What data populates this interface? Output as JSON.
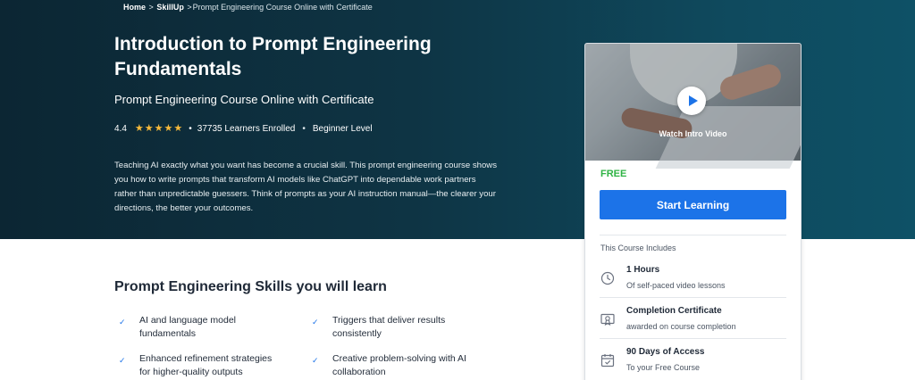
{
  "breadcrumb": {
    "home": "Home",
    "sep1": ">",
    "skillup": "SkillUp",
    "sep2": ">",
    "current": "Prompt Engineering Course Online with Certificate"
  },
  "course": {
    "title": "Introduction to Prompt Engineering Fundamentals",
    "subtitle": "Prompt Engineering Course Online with Certificate",
    "rating": "4.4",
    "rating_stars": 5,
    "learners": "37735 Learners Enrolled",
    "level": "Beginner Level",
    "meta_separator": "•",
    "description": "Teaching AI exactly what you want has become a crucial skill. This prompt engineering course shows you how to write prompts that transform AI models like ChatGPT into dependable work partners rather than unpredictable guessers. Think of prompts as your AI instruction manual—the clearer your directions, the better your outcomes."
  },
  "card": {
    "video_label": "Watch Intro Video",
    "price": "FREE",
    "cta_label": "Start Learning",
    "includes_title": "This Course Includes",
    "includes": [
      {
        "icon": "clock-icon",
        "title": "1 Hours",
        "subtitle": "Of self-paced video lessons"
      },
      {
        "icon": "certificate-icon",
        "title": "Completion Certificate",
        "subtitle": "awarded on course completion"
      },
      {
        "icon": "calendar-icon",
        "title": "90 Days of Access",
        "subtitle": "To your Free Course"
      }
    ]
  },
  "skills": {
    "heading": "Prompt Engineering Skills you will learn",
    "items": [
      "AI and language model fundamentals",
      "Triggers that deliver results consistently",
      "Enhanced refinement strategies for higher-quality outputs",
      "Creative problem-solving with AI collaboration"
    ]
  },
  "colors": {
    "hero_background": "#0e3444",
    "accent_blue": "#1c73e8",
    "price_green": "#2fb344",
    "star_gold": "#f6b93b"
  }
}
